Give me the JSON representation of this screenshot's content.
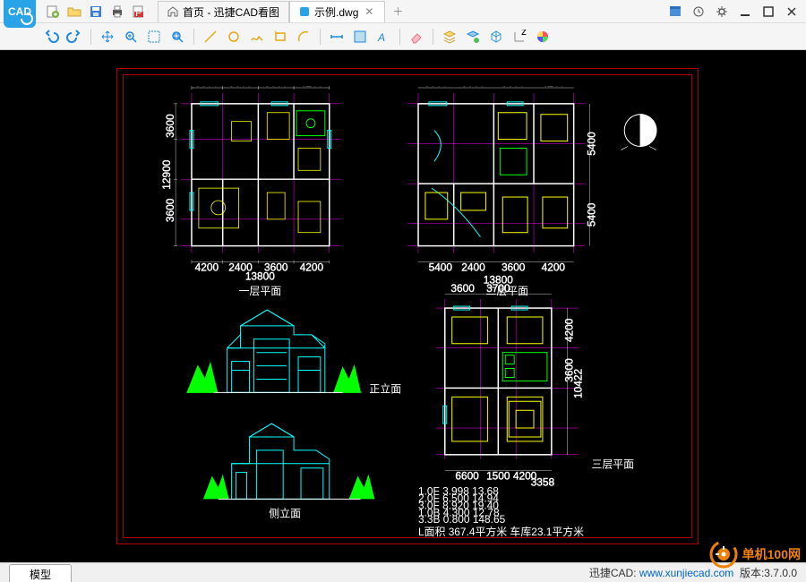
{
  "app_icon_text": "CAD",
  "tabs": {
    "home": {
      "label": "首页 - 迅捷CAD看图"
    },
    "file": {
      "label": "示例.dwg"
    }
  },
  "model_tab": "模型",
  "status": {
    "brand": "迅捷CAD:",
    "url": "www.xunjiecad.com",
    "version_label": "版本:",
    "version": "3.7.0.0"
  },
  "watermark": "单机100网",
  "drawing_labels": {
    "plan1": "一层平面",
    "plan2": "二层平面",
    "plan3": "三层平面",
    "elev1": "正立面",
    "elev2": "侧立面",
    "summary": "L面积  367.4平方米  车库23.1平方米"
  },
  "dims": {
    "top1_total": "16200",
    "top1_a": "3600",
    "top1_b": "3500",
    "top1_c": "3600",
    "top1_d": "4200",
    "left1": "12900",
    "left1a": "3600",
    "left1b": "3600",
    "bot1_a": "4200",
    "bot1_b": "2400",
    "bot1_c": "3600",
    "bot1_d": "4200",
    "bot1_total": "13800",
    "top2_total": "18600",
    "top2_a": "3600",
    "top2_b": "3900",
    "top2_c": "3600",
    "top2_d": "4200",
    "bot2_a": "5400",
    "bot2_b": "2400",
    "bot2_c": "3600",
    "bot2_d": "4200",
    "right2": "5400",
    "right2b": "5400",
    "top3_a": "3600",
    "top3_b": "3700",
    "top3_total": "13800",
    "right3": "4200",
    "right3b": "3600",
    "right3c": "10422",
    "bot3_a": "6600",
    "bot3_b": "1500",
    "bot3_c": "4200",
    "bot3_d": "3358"
  }
}
